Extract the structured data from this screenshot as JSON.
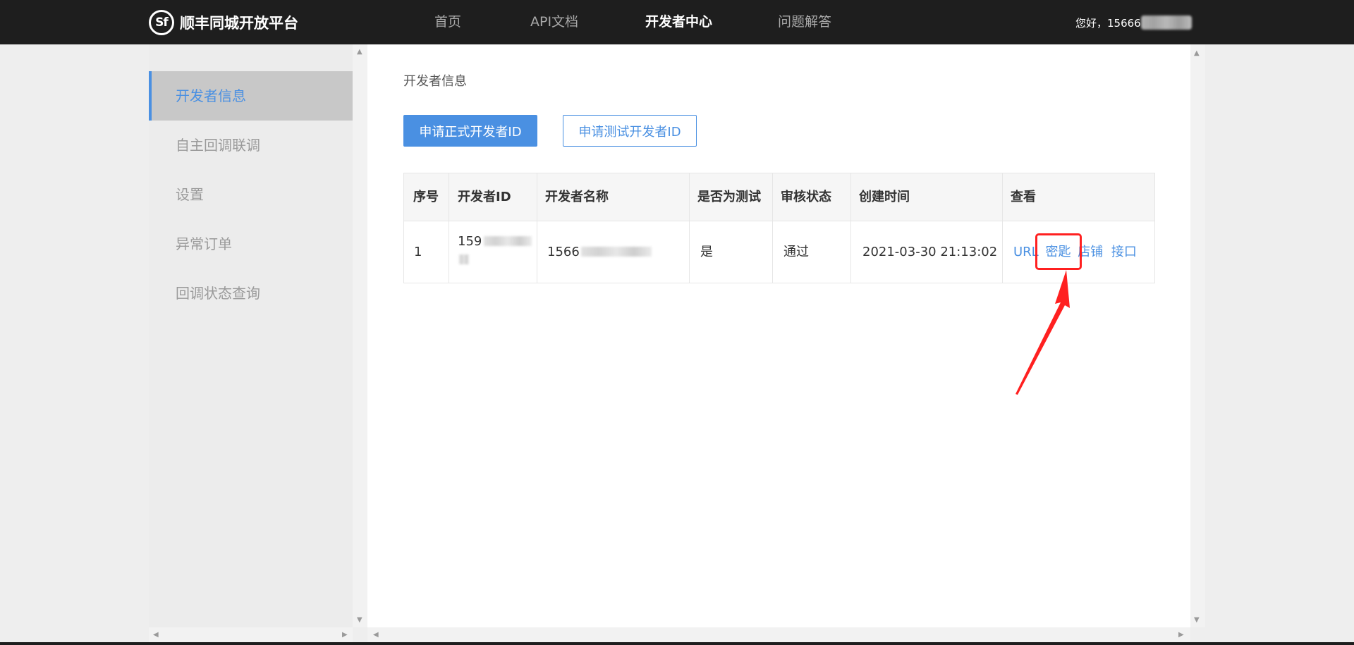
{
  "header": {
    "logo_mark": "Sf",
    "logo_text": "顺丰同城开放平台",
    "nav": [
      "首页",
      "API文档",
      "开发者中心",
      "问题解答"
    ],
    "greeting": "您好，15666"
  },
  "sidebar": {
    "items": [
      {
        "label": "开发者信息"
      },
      {
        "label": "自主回调联调"
      },
      {
        "label": "设置"
      },
      {
        "label": "异常订单"
      },
      {
        "label": "回调状态查询"
      }
    ]
  },
  "main": {
    "title": "开发者信息",
    "apply_formal_label": "申请正式开发者ID",
    "apply_test_label": "申请测试开发者ID",
    "table": {
      "columns": [
        "序号",
        "开发者ID",
        "开发者名称",
        "是否为测试",
        "审核状态",
        "创建时间",
        "查看"
      ],
      "rows": [
        {
          "index": "1",
          "dev_id": "159",
          "dev_name": "1566",
          "is_test": "是",
          "status": "通过",
          "created": "2021-03-30 21:13:02",
          "actions": [
            "URL",
            "密匙",
            "店铺",
            "接口"
          ]
        }
      ]
    }
  },
  "colors": {
    "accent": "#4a90e2",
    "header_bg": "#1e1e1e",
    "highlight": "#ff2020"
  }
}
